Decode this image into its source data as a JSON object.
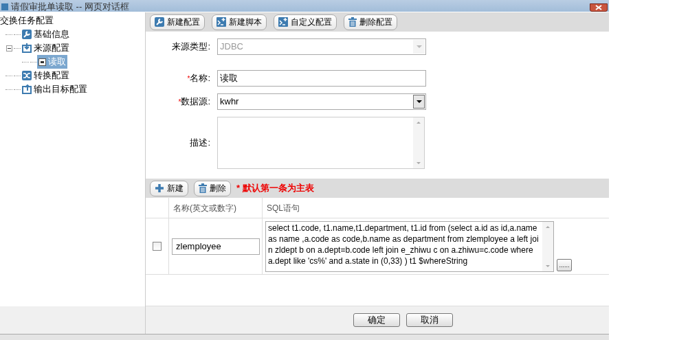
{
  "window": {
    "title": "请假审批单读取 -- 网页对话框"
  },
  "tree": {
    "label": "交换任务配置",
    "children": [
      {
        "label": "基础信息",
        "selected": false
      },
      {
        "label": "来源配置",
        "expanded": true,
        "selected": false,
        "children": [
          {
            "label": "读取",
            "selected": true
          }
        ]
      },
      {
        "label": "转换配置",
        "selected": false
      },
      {
        "label": "输出目标配置",
        "selected": false
      }
    ]
  },
  "toolbar": [
    {
      "label": "新建配置"
    },
    {
      "label": "新建脚本"
    },
    {
      "label": "自定义配置"
    },
    {
      "label": "删除配置"
    }
  ],
  "form": [
    {
      "kind": "select",
      "label": "来源类型:",
      "disabled": true,
      "value": "JDBC"
    },
    {
      "kind": "text",
      "required_mark": "*",
      "label": "名称:",
      "value": "读取"
    },
    {
      "kind": "select",
      "required_mark": "*",
      "label": "数据源:",
      "disabled": false,
      "value": "kwhr"
    },
    {
      "kind": "textarea",
      "label": "描述:"
    }
  ],
  "grid_toolbar": {
    "buttons": [
      {
        "label": "新建"
      },
      {
        "label": "删除"
      }
    ],
    "note": "* 默认第一条为主表"
  },
  "table": {
    "columns": [
      "名称(英文或数字)",
      "SQL语句"
    ],
    "rows": [
      {
        "checked": false,
        "name": "zlemployee",
        "sql": "select t1.code, t1.name,t1.department, t1.id  from (select a.id as id,a.name as name ,a.code as code,b.name as department from zlemployee a left join zldept b on a.dept=b.code left join  e_zhiwu c on a.zhiwu=c.code where a.dept like 'cs%' and a.state in (0,33) ) t1  $whereString",
        "more": "......"
      }
    ]
  },
  "footer_buttons": [
    "确定",
    "取消"
  ]
}
